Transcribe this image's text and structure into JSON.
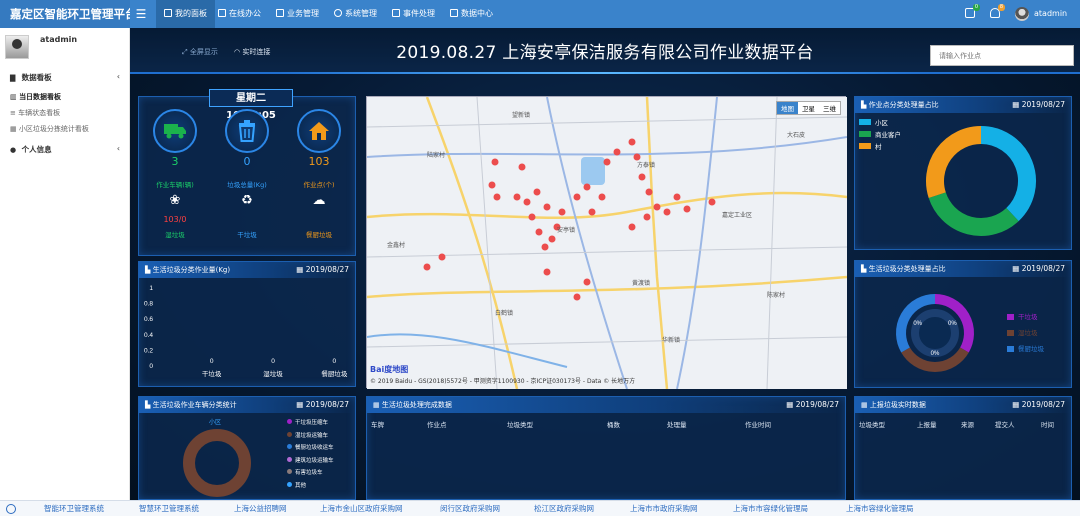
{
  "app": {
    "title": "嘉定区智能环卫管理平台"
  },
  "topnav": [
    {
      "label": "我的面板",
      "active": true
    },
    {
      "label": "在线办公",
      "active": false
    },
    {
      "label": "业务管理",
      "active": false
    },
    {
      "label": "系统管理",
      "active": false
    },
    {
      "label": "事件处理",
      "active": false
    },
    {
      "label": "数据中心",
      "active": false
    }
  ],
  "user": {
    "name": "atadmin",
    "notif_count": "8",
    "msg_count": "0"
  },
  "sidebar": {
    "username": "atadmin",
    "sections": [
      {
        "label": "数据看板",
        "items": [
          "当日数据看板",
          "车辆状态看板",
          "小区垃圾分拣统计看板"
        ]
      },
      {
        "label": "个人信息",
        "items": []
      }
    ]
  },
  "header": {
    "fullscreen": "全屏显示",
    "connection": "实时连接",
    "title": "2019.08.27 上海安亭保洁服务有限公司作业数据平台",
    "search_placeholder": "请输入作业点"
  },
  "stats": {
    "clock": "星期二 10:06:05",
    "cards": [
      {
        "icon": "truck-icon",
        "value": "3",
        "label": "作业车辆(辆)"
      },
      {
        "icon": "trash-can-icon",
        "value": "0",
        "label": "垃圾总量(Kg)"
      },
      {
        "icon": "house-icon",
        "value": "103",
        "label": "作业点(个)"
      }
    ],
    "types": [
      {
        "icon": "wet-waste-icon",
        "value": "103/0",
        "label": "湿垃圾"
      },
      {
        "icon": "recycle-icon",
        "value": "",
        "label": "干垃圾"
      },
      {
        "icon": "kitchen-waste-icon",
        "value": "",
        "label": "餐厨垃圾"
      }
    ]
  },
  "panels": {
    "bar": {
      "title": "生活垃圾分类作业量(Kg)",
      "date": "2019/08/27"
    },
    "map": {
      "title": "",
      "map_type_buttons": [
        "地图",
        "卫星",
        "三维"
      ],
      "credit": "© 2019 Baidu - GS(2018)5572号 - 甲测资字1100930 - 京ICP证030173号 - Data © 长地万方",
      "logo": "Bai度地图",
      "places": [
        "望新镇",
        "方泰镇",
        "黄渡镇",
        "白鹤镇",
        "华新镇",
        "安亭镇",
        "嘉定工业区",
        "金鑫村",
        "陆家村",
        "陈家村",
        "大石皮"
      ]
    },
    "donut1": {
      "title": "作业点分类处理量占比",
      "date": "2019/08/27",
      "legend": [
        "小区",
        "商业客户",
        "村"
      ]
    },
    "donut2": {
      "title": "生活垃圾分类处理量占比",
      "date": "2019/08/27",
      "labels": [
        "0%",
        "0%",
        "0%"
      ],
      "legend": [
        "干垃圾",
        "湿垃圾",
        "餐厨垃圾"
      ]
    },
    "veh": {
      "title": "生活垃圾作业车辆分类统计",
      "date": "2019/08/27",
      "center_label": "小区",
      "legend": [
        "干垃圾压缩车",
        "湿垃圾运输车",
        "餐厨垃圾收运车",
        "建筑垃圾运输车",
        "有害垃圾车",
        "其他"
      ]
    },
    "trash": {
      "title": "生活垃圾处理完成数据",
      "date": "2019/08/27",
      "columns": [
        "车牌",
        "作业点",
        "垃圾类型",
        "桶数",
        "处理量",
        "作业时间"
      ]
    },
    "report": {
      "title": "上报垃圾实时数据",
      "date": "2019/08/27",
      "columns": [
        "垃圾类型",
        "上报量",
        "来源",
        "提交人",
        "时间"
      ]
    }
  },
  "colors": {
    "accent": "#1f6fd0",
    "cyan": "#14b0e6",
    "green": "#1aa550",
    "orange": "#f29a1a",
    "purple": "#a020c8",
    "brown": "#6e4233",
    "blue": "#2a7cd8"
  },
  "chart_data": [
    {
      "type": "bar",
      "title": "生活垃圾分类作业量(Kg)",
      "categories": [
        "干垃圾",
        "湿垃圾",
        "餐厨垃圾"
      ],
      "values": [
        0,
        0,
        0
      ],
      "ylim": [
        0,
        1
      ],
      "yticks": [
        "0",
        "0.2",
        "0.4",
        "0.6",
        "0.8",
        "1"
      ]
    },
    {
      "type": "pie",
      "title": "作业点分类处理量占比",
      "categories": [
        "小区",
        "商业客户",
        "村"
      ],
      "values": [
        38,
        32,
        30
      ],
      "colors": [
        "#14b0e6",
        "#1aa550",
        "#f29a1a"
      ]
    },
    {
      "type": "pie",
      "title": "生活垃圾分类处理量占比",
      "categories": [
        "干垃圾",
        "湿垃圾",
        "餐厨垃圾"
      ],
      "values": [
        0,
        0,
        0
      ],
      "labels": [
        "0%",
        "0%",
        "0%"
      ],
      "colors": [
        "#a020c8",
        "#6e4233",
        "#2a7cd8"
      ]
    }
  ],
  "footer": {
    "links": [
      "智能环卫管理系统",
      "智慧环卫管理系统",
      "上海公益招聘网",
      "上海市金山区政府采购网",
      "闵行区政府采购网",
      "松江区政府采购网",
      "上海市市政府采购网",
      "上海市市容绿化管理局",
      "上海市容绿化管理局"
    ]
  }
}
